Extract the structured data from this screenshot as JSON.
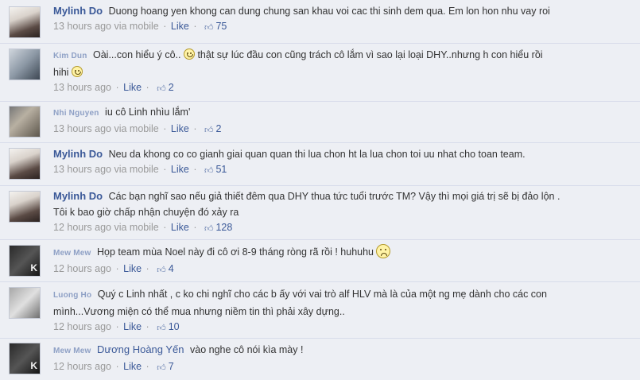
{
  "comments": [
    {
      "name": "Mylinh Do",
      "text": "Duong hoang yen khong can dung chung san khau voi cac thi sinh dem qua. Em lon hon nhu vay roi",
      "time": "13 hours ago",
      "via": "via mobile",
      "like_label": "Like",
      "likes": "75",
      "avatar": "woman"
    },
    {
      "name": "Kim Dun",
      "text": "Oài...con hiểu ý cô..",
      "text_after_emoji": "thật sự lúc đầu con cũng trách cô lắm vì sao lại loại DHY..nhưng h con hiểu rồi",
      "text_line2": "hihi",
      "time": "13 hours ago",
      "like_label": "Like",
      "likes": "2",
      "avatar": "man1",
      "emoji": "smile-icon"
    },
    {
      "name": "Nhi Nguyen",
      "text": "iu cô Linh nhìu lắm'",
      "time": "13 hours ago",
      "via": "via mobile",
      "like_label": "Like",
      "likes": "2",
      "avatar": "man2"
    },
    {
      "name": "Mylinh Do",
      "text": "Neu da khong co co gianh giai quan quan thi lua chon ht la lua chon toi uu nhat cho toan team.",
      "time": "13 hours ago",
      "via": "via mobile",
      "like_label": "Like",
      "likes": "51",
      "avatar": "woman"
    },
    {
      "name": "Mylinh Do",
      "text": "Các bạn nghĩ sao nếu giả thiết đêm qua DHY thua tức tuổi trước TM? Vậy thì mọi giá trị sẽ bị đảo lộn .",
      "text_line2": "Tôi k bao giờ chấp nhận chuyện đó xảy ra",
      "time": "12 hours ago",
      "via": "via mobile",
      "like_label": "Like",
      "likes": "128",
      "avatar": "woman"
    },
    {
      "name": "Mew Mew",
      "text": "Họp team mùa Noel này đi cô ơi 8-9 tháng ròng rã rồi ! huhuhu",
      "time": "12 hours ago",
      "like_label": "Like",
      "likes": "4",
      "avatar": "dark",
      "emoji": "sad-icon"
    },
    {
      "name": "Luong Ho",
      "text": "Quý c Linh nhất , c ko chi nghĩ cho các b ấy với vai trò alf HLV mà là của một ng mẹ dành cho các con",
      "text_line2": "mình...Vương miện có thể mua nhưng niềm tin thì phải xây dựng..",
      "time": "12 hours ago",
      "like_label": "Like",
      "likes": "10",
      "avatar": "gray"
    },
    {
      "name": "Mew Mew",
      "text": "vào nghe cô nói kìa mày !",
      "tag": "Dương Hoàng Yến",
      "time": "12 hours ago",
      "like_label": "Like",
      "likes": "7",
      "avatar": "dark"
    }
  ]
}
